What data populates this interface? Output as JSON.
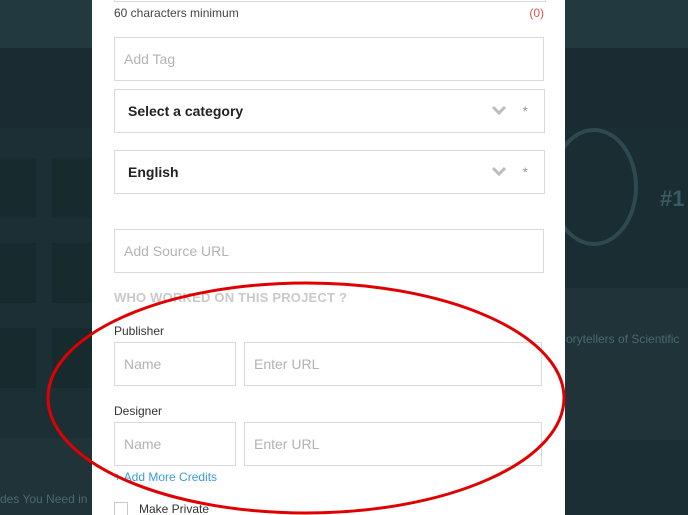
{
  "form": {
    "hint": "60 characters minimum",
    "char_count": "(0)",
    "tag_placeholder": "Add Tag",
    "category_value": "Select a category",
    "language_value": "English",
    "required_mark": "*",
    "source_url_placeholder": "Add Source URL",
    "credits_section_title": "WHO WORKED ON THIS PROJECT ?",
    "credits": [
      {
        "role": "Publisher",
        "name_placeholder": "Name",
        "url_placeholder": "Enter URL"
      },
      {
        "role": "Designer",
        "name_placeholder": "Name",
        "url_placeholder": "Enter URL"
      }
    ],
    "add_more_credits": "+ Add More Credits",
    "make_private_label": "Make Private"
  },
  "background": {
    "rank_text": "#1",
    "story_text": "orytellers of Scientific",
    "bottom_text": "des You Need in"
  },
  "colors": {
    "accent_link": "#3b9ad9",
    "counter_red": "#d9534f",
    "annotation_red": "#e00000"
  }
}
